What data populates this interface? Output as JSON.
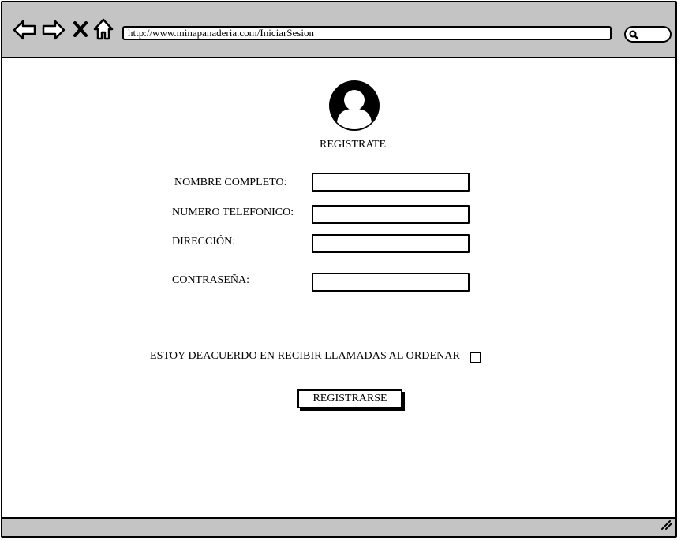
{
  "browser": {
    "url": "http://www.minapanaderia.com/IniciarSesion",
    "icons": [
      "back-arrow-icon",
      "forward-arrow-icon",
      "close-icon",
      "home-icon",
      "search-icon",
      "resize-grip-icon"
    ]
  },
  "form": {
    "title": "REGISTRATE",
    "fields": [
      {
        "label": "NOMBRE COMPLETO:",
        "value": ""
      },
      {
        "label": "NUMERO TELEFONICO:",
        "value": ""
      },
      {
        "label": "DIRECCIÓN:",
        "value": ""
      },
      {
        "label": "CONTRASEÑA:",
        "value": ""
      }
    ],
    "terms_label": "ESTOY DEACUERDO EN RECIBIR LLAMADAS AL ORDENAR",
    "terms_checked": false,
    "submit_label": "REGISTRARSE"
  }
}
